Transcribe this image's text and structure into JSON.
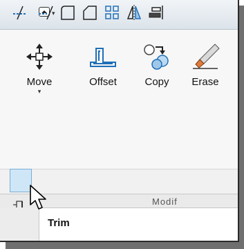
{
  "toolbar": {
    "quick_access_arrow": "▾"
  },
  "tools": {
    "move": "Move",
    "offset": "Offset",
    "copy": "Copy",
    "erase": "Erase"
  },
  "panel": {
    "label": "Modif"
  },
  "tooltip": {
    "title": "Trim"
  },
  "colors": {
    "accent_blue": "#1f6fb7",
    "hover_blue": "#cfe6f7",
    "dark": "#2a2a2a"
  },
  "icons": [
    "move-icon",
    "offset-icon",
    "copy-icon",
    "erase-icon",
    "trim-icon",
    "extend-icon",
    "fillet-icon",
    "chamfer-icon",
    "array-icon",
    "mirror-icon",
    "align-icon",
    "pin-icon",
    "cursor-icon"
  ]
}
